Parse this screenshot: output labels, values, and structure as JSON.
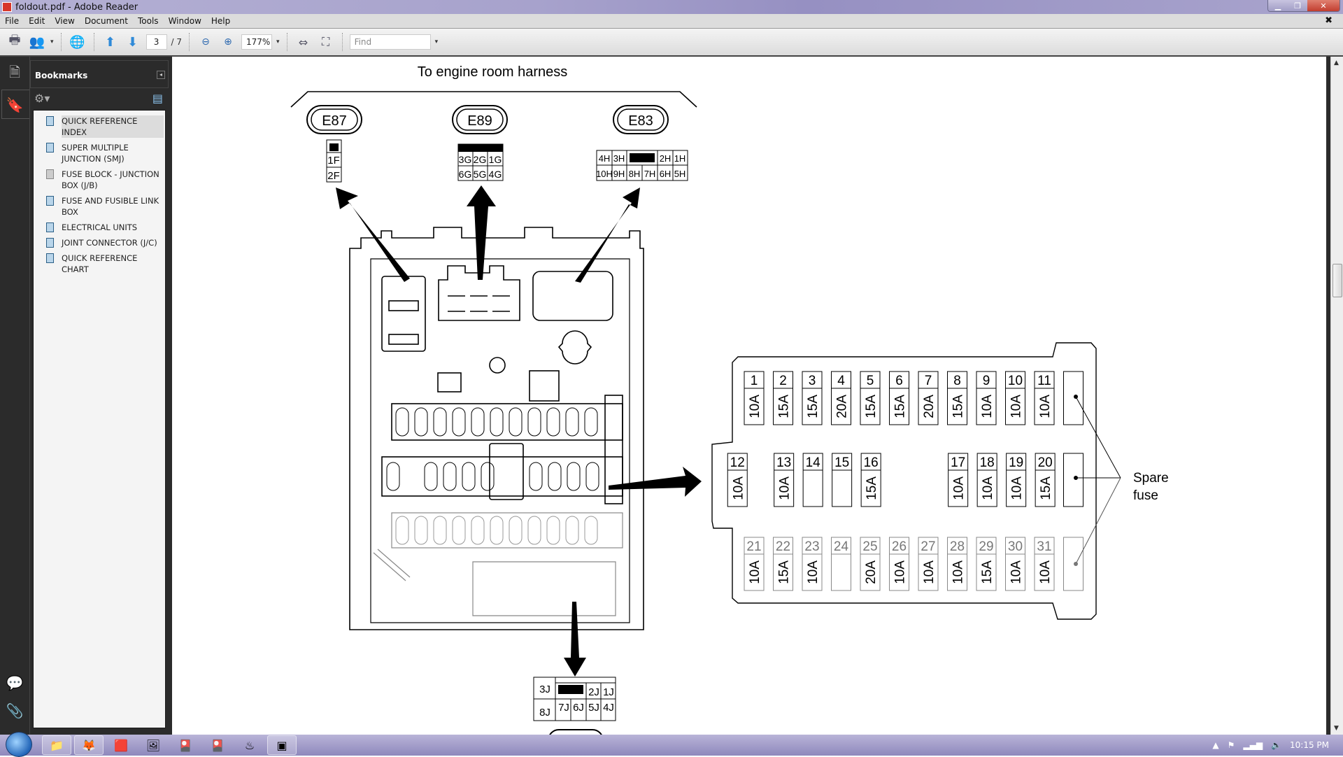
{
  "window": {
    "title": "foldout.pdf - Adobe Reader"
  },
  "menu": [
    "File",
    "Edit",
    "View",
    "Document",
    "Tools",
    "Window",
    "Help"
  ],
  "toolbar": {
    "current_page": "3",
    "total_pages": "/ 7",
    "zoom": "177%",
    "find_placeholder": "Find"
  },
  "bookmarks": {
    "title": "Bookmarks",
    "items": [
      {
        "label": "QUICK REFERENCE INDEX",
        "selected": true
      },
      {
        "label": "SUPER MULTIPLE JUNCTION (SMJ)"
      },
      {
        "label": "FUSE BLOCK - JUNCTION BOX (J/B)",
        "current": true
      },
      {
        "label": "FUSE AND FUSIBLE LINK BOX"
      },
      {
        "label": "ELECTRICAL UNITS"
      },
      {
        "label": "JOINT CONNECTOR (J/C)"
      },
      {
        "label": "QUICK REFERENCE CHART"
      }
    ]
  },
  "diagram": {
    "heading": "To engine room harness",
    "connectors": {
      "E87": {
        "label": "E87",
        "pins": [
          [
            "1F"
          ],
          [
            "2F"
          ]
        ]
      },
      "E89": {
        "label": "E89",
        "pins": [
          [
            "3G",
            "2G",
            "1G"
          ],
          [
            "6G",
            "5G",
            "4G"
          ]
        ]
      },
      "E83": {
        "label": "E83",
        "pins": [
          [
            "4H",
            "3H",
            "",
            "2H",
            "1H"
          ],
          [
            "10H",
            "9H",
            "8H",
            "7H",
            "6H",
            "5H"
          ]
        ]
      },
      "bottom": {
        "pins_top": [
          "3J",
          "",
          "2J",
          "1J"
        ],
        "pins_bottom": [
          "8J",
          "7J",
          "6J",
          "5J",
          "4J"
        ]
      }
    },
    "fuses": {
      "row1": [
        {
          "n": "1",
          "a": "10A"
        },
        {
          "n": "2",
          "a": "15A"
        },
        {
          "n": "3",
          "a": "15A"
        },
        {
          "n": "4",
          "a": "20A"
        },
        {
          "n": "5",
          "a": "15A"
        },
        {
          "n": "6",
          "a": "15A"
        },
        {
          "n": "7",
          "a": "20A"
        },
        {
          "n": "8",
          "a": "15A"
        },
        {
          "n": "9",
          "a": "10A"
        },
        {
          "n": "10",
          "a": "10A"
        },
        {
          "n": "11",
          "a": "10A"
        }
      ],
      "row2": [
        {
          "n": "12",
          "a": "10A"
        },
        {
          "n": "13",
          "a": "10A"
        },
        {
          "n": "14",
          "a": ""
        },
        {
          "n": "15",
          "a": ""
        },
        {
          "n": "16",
          "a": "15A"
        },
        {
          "n": "17",
          "a": "10A"
        },
        {
          "n": "18",
          "a": "10A"
        },
        {
          "n": "19",
          "a": "10A"
        },
        {
          "n": "20",
          "a": "15A"
        }
      ],
      "row3": [
        {
          "n": "21",
          "a": "10A"
        },
        {
          "n": "22",
          "a": "15A"
        },
        {
          "n": "23",
          "a": "10A"
        },
        {
          "n": "24",
          "a": ""
        },
        {
          "n": "25",
          "a": "20A"
        },
        {
          "n": "26",
          "a": "10A"
        },
        {
          "n": "27",
          "a": "10A"
        },
        {
          "n": "28",
          "a": "10A"
        },
        {
          "n": "29",
          "a": "15A"
        },
        {
          "n": "30",
          "a": "10A"
        },
        {
          "n": "31",
          "a": "10A"
        }
      ],
      "spare_label_1": "Spare",
      "spare_label_2": "fuse"
    }
  },
  "taskbar": {
    "apps": [
      "windows-explorer",
      "firefox",
      "app-3",
      "picture-viewer",
      "app-5",
      "app-6",
      "steam",
      "icon-editor"
    ],
    "clock": "10:15 PM"
  }
}
